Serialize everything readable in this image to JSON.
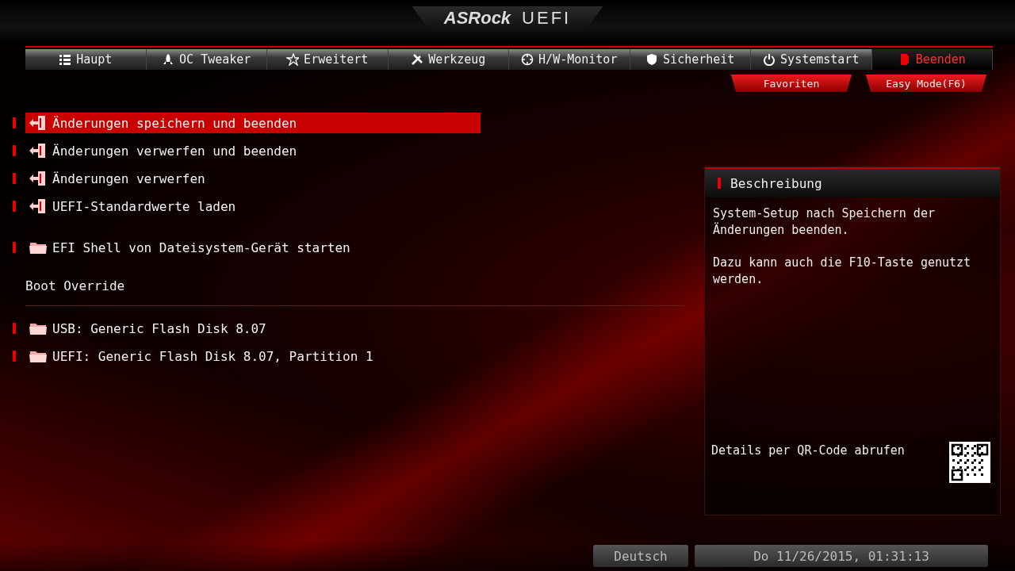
{
  "header": {
    "logo": "ASRock",
    "title": "UEFI"
  },
  "tabs": [
    {
      "label": "Haupt",
      "selected": false
    },
    {
      "label": "OC Tweaker",
      "selected": false
    },
    {
      "label": "Erweitert",
      "selected": false
    },
    {
      "label": "Werkzeug",
      "selected": false
    },
    {
      "label": "H/W-Monitor",
      "selected": false
    },
    {
      "label": "Sicherheit",
      "selected": false
    },
    {
      "label": "Systemstart",
      "selected": false
    },
    {
      "label": "Beenden",
      "selected": true
    }
  ],
  "quick_buttons": [
    "Favoriten",
    "Easy Mode(F6)"
  ],
  "sections": [
    {
      "items": [
        {
          "kind": "exit",
          "label": "Änderungen speichern und beenden",
          "selected": true
        },
        {
          "kind": "exit",
          "label": "Änderungen verwerfen und beenden",
          "selected": false
        },
        {
          "kind": "exit",
          "label": "Änderungen verwerfen",
          "selected": false
        },
        {
          "kind": "exit",
          "label": "UEFI-Standardwerte laden",
          "selected": false
        }
      ]
    },
    {
      "items": [
        {
          "kind": "folder",
          "label": "EFI Shell von Dateisystem-Gerät starten",
          "selected": false
        }
      ]
    },
    {
      "heading": "Boot Override",
      "items": [
        {
          "kind": "folder",
          "label": "USB: Generic Flash Disk 8.07",
          "selected": false
        },
        {
          "kind": "folder",
          "label": "UEFI: Generic Flash Disk 8.07, Partition 1",
          "selected": false
        }
      ]
    }
  ],
  "description": {
    "title": "Beschreibung",
    "paragraphs": [
      "System-Setup nach Speichern der Änderungen beenden.",
      "Dazu kann auch die F10-Taste genutzt werden."
    ],
    "qr_label": "Details per QR-Code abrufen"
  },
  "status_bar": {
    "language": "Deutsch",
    "datetime": "Do 11/26/2015, 01:31:13"
  }
}
